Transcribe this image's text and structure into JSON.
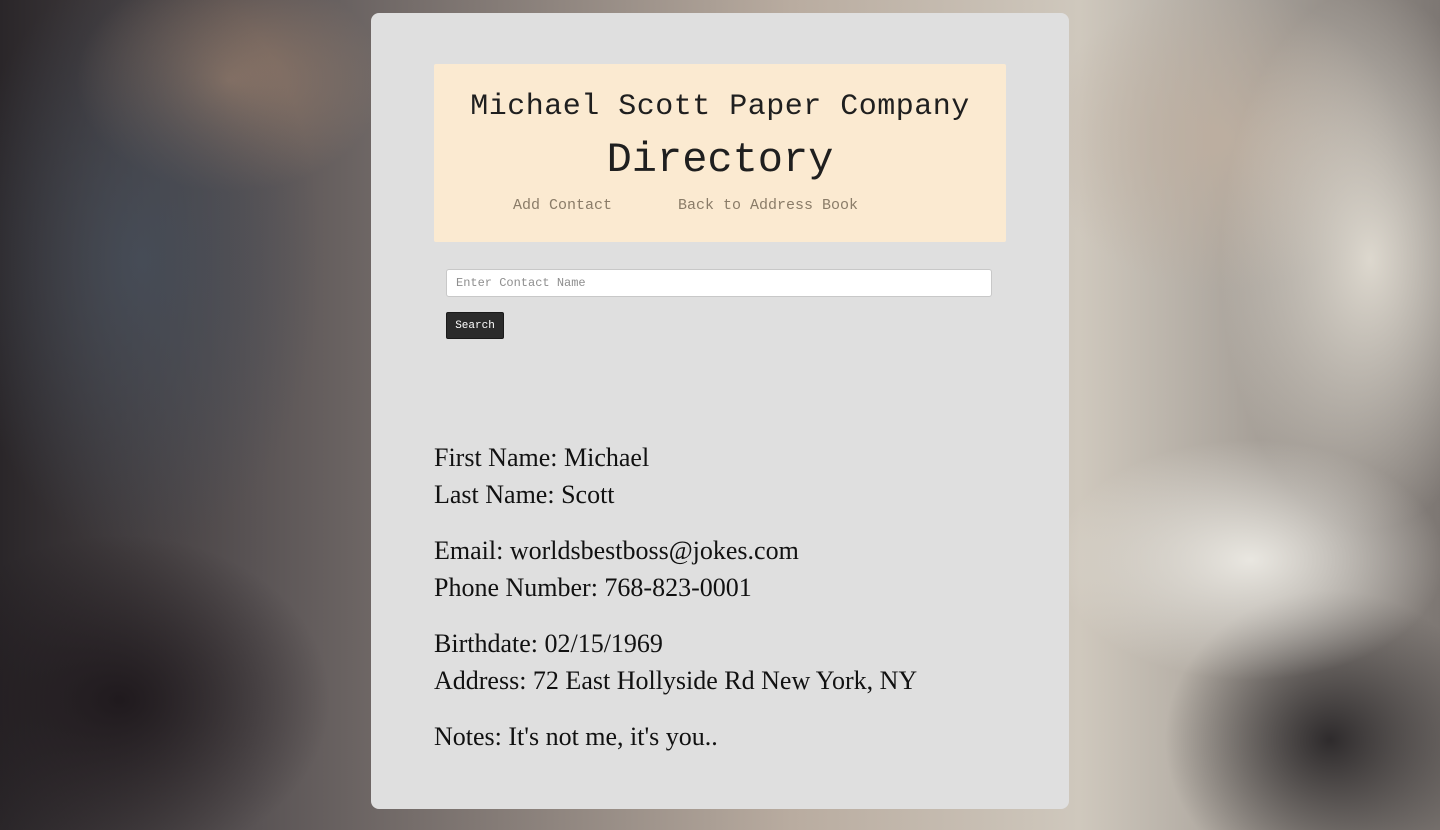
{
  "header": {
    "company_name": "Michael Scott Paper Company",
    "title": "Directory",
    "nav": {
      "add_contact": "Add Contact",
      "back_to_address_book": "Back to Address Book"
    }
  },
  "search": {
    "placeholder": "Enter Contact Name",
    "value": "",
    "button_label": "Search"
  },
  "contact": {
    "first_name": "First Name: Michael",
    "last_name": "Last Name: Scott",
    "email": "Email: worldsbestboss@jokes.com",
    "phone": "Phone Number: 768-823-0001",
    "birthdate": "Birthdate: 02/15/1969",
    "address": "Address: 72 East Hollyside Rd New York, NY",
    "notes": "Notes: It's not me, it's you.."
  },
  "colors": {
    "card_background": "#dfdfdf",
    "header_background": "#fbead1",
    "nav_link": "#8a7c68",
    "button_background": "#2b2b2b"
  }
}
